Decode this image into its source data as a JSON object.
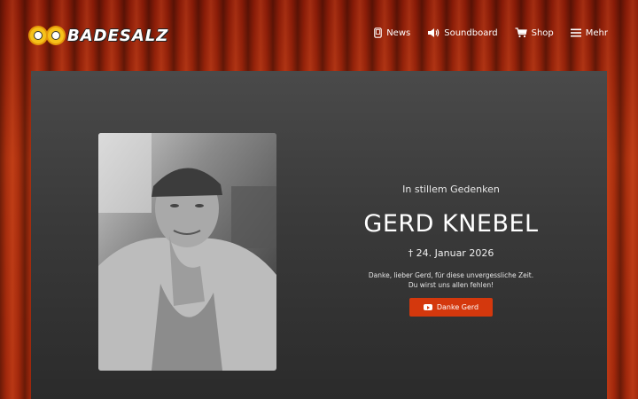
{
  "brand": {
    "logo_text": "BADESALZ",
    "logo_icon": "two-sun-faces-logo"
  },
  "nav": {
    "items": [
      {
        "label": "News",
        "icon": "phone-icon"
      },
      {
        "label": "Soundboard",
        "icon": "speaker-icon"
      },
      {
        "label": "Shop",
        "icon": "cart-icon"
      },
      {
        "label": "Mehr",
        "icon": "hamburger-menu-icon"
      }
    ]
  },
  "memorial": {
    "subtitle": "In stillem Gedenken",
    "name": "GERD KNEBEL",
    "date": "† 24. Januar 2026",
    "message_line1": "Danke, lieber Gerd, für diese unvergessliche Zeit.",
    "message_line2": "Du wirst uns allen fehlen!",
    "button_label": "Danke Gerd",
    "button_icon": "youtube-icon"
  },
  "colors": {
    "curtain": "#a9290c",
    "panel": "#3a3a3a",
    "accent": "#d4380d",
    "text": "#ffffff"
  }
}
